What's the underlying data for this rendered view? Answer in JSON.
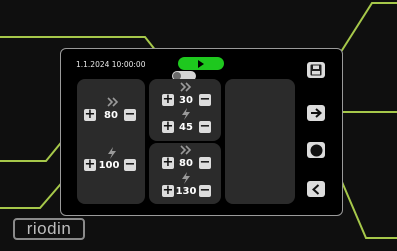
{
  "header": {
    "timestamp": "1.1.2024 10:00:00",
    "play_icon": "play-icon"
  },
  "left_card": {
    "fast_value": "80",
    "slow_value": "100",
    "fast_icon": "double-chevron-right-icon",
    "slow_icon": "lightning-icon"
  },
  "mid_top_card": {
    "fast_value": "30",
    "slow_value": "45"
  },
  "mid_bottom_card": {
    "fast_value": "80",
    "slow_value": "130"
  },
  "buttons": {
    "plus": "+",
    "minus": "−"
  },
  "sidebar": {
    "items": [
      {
        "icon": "save-icon"
      },
      {
        "icon": "arrow-right-icon"
      },
      {
        "icon": "record-icon"
      },
      {
        "icon": "chevron-left-icon"
      }
    ]
  },
  "brand": {
    "logo": "riodin"
  },
  "colors": {
    "accent_green": "#1ec81e",
    "callout_green": "#a6c84a",
    "card": "#2b2b2b",
    "button": "#dcdcdc"
  }
}
